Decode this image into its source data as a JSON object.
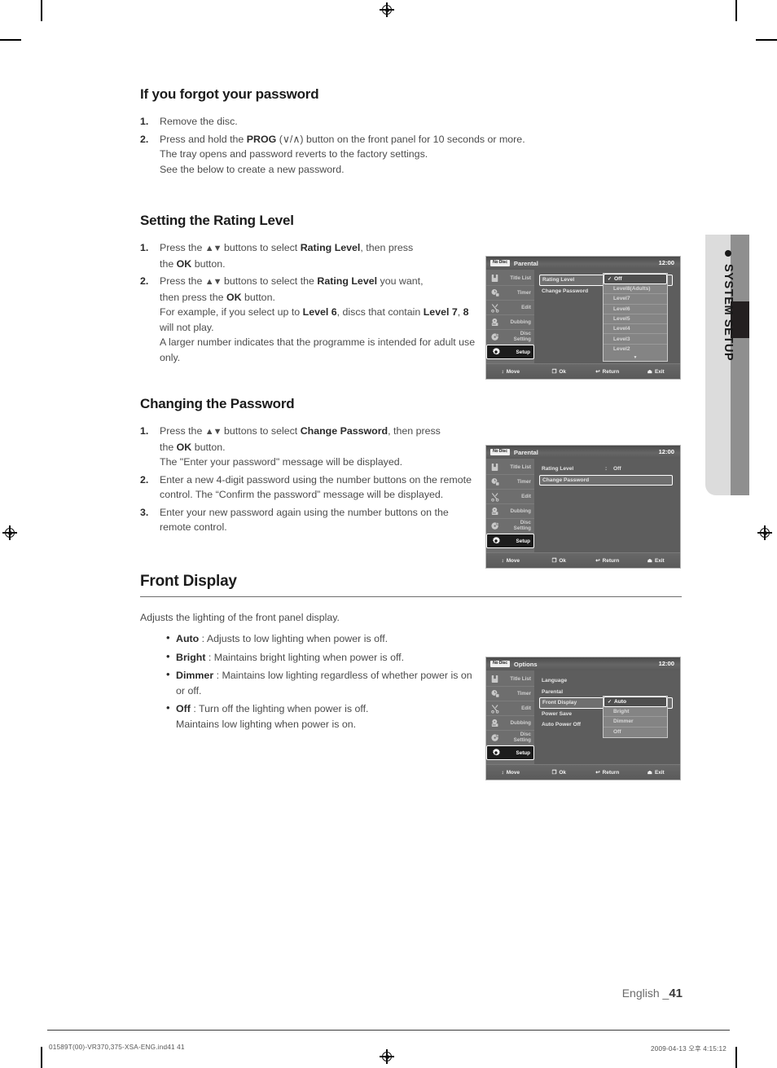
{
  "page": {
    "number": "41",
    "language_label": "English _",
    "side_tab": "SYSTEM SETUP",
    "footer_left": "01589T(00)-VR370,375-XSA-ENG.ind41   41",
    "footer_right": "2009-04-13   오후 4:15:12"
  },
  "sections": [
    {
      "id": "forgot_password",
      "title": "If you forgot your password",
      "steps": [
        {
          "num": "1.",
          "html": "Remove the disc."
        },
        {
          "num": "2.",
          "html": "Press and hold the <b>PROG</b> (∨/∧) button on the front panel for 10 seconds or more.<br>The tray opens and password reverts to the factory settings.<br>See the below  to create a new password."
        }
      ]
    },
    {
      "id": "rating_level",
      "title": "Setting the Rating Level",
      "steps": [
        {
          "num": "1.",
          "html": "Press the <span class=\"arrows\">▲▼</span> buttons to select <b>Rating Level</b>, then press<br>the <b>OK</b> button."
        },
        {
          "num": "2.",
          "html": "Press the <span class=\"arrows\">▲▼</span> buttons to select the <b>Rating Level</b> you want,<br>then press the <b>OK</b> button.<br>For example, if you select up to <b>Level 6</b>, discs that contain <b>Level 7</b>, <b>8</b> will not play.<br>A larger number indicates that the programme is intended for adult use only."
        }
      ]
    },
    {
      "id": "change_password",
      "title": "Changing the Password",
      "steps": [
        {
          "num": "1.",
          "html": "Press the <span class=\"arrows\">▲▼</span> buttons to select <b>Change Password</b>, then press<br>the <b>OK</b> button.<br>The \"Enter your password\" message will be displayed."
        },
        {
          "num": "2.",
          "html": "Enter a new 4-digit password using the number buttons on the remote control. The “Confirm the password” message will be displayed."
        },
        {
          "num": "3.",
          "html": "Enter your new password again using the number buttons on the remote control."
        }
      ]
    },
    {
      "id": "front_display",
      "title": "Front Display",
      "lead": "Adjusts the lighting of the front panel display.",
      "bullets": [
        {
          "term": "Auto",
          "desc": " : Adjusts to low lighting when power is off."
        },
        {
          "term": "Bright",
          "desc": " : Maintains bright lighting when power is off."
        },
        {
          "term": "Dimmer",
          "desc": " : Maintains low lighting regardless of whether power is on or off."
        },
        {
          "term": "Off",
          "desc": " : Turn off the lighting when power is off.<br>Maintains low lighting when power is on."
        }
      ]
    }
  ],
  "osd_common": {
    "disc_badge": "No Disc",
    "clock": "12:00",
    "sidebar": [
      {
        "label": "Title List",
        "icon": "title-list-icon"
      },
      {
        "label": "Timer",
        "icon": "timer-icon"
      },
      {
        "label": "Edit",
        "icon": "edit-scissors-icon"
      },
      {
        "label": "Dubbing",
        "icon": "dubbing-icon"
      },
      {
        "label": "Disc Setting",
        "icon": "disc-setting-icon"
      },
      {
        "label": "Setup",
        "icon": "gear-icon"
      }
    ],
    "footer": [
      {
        "icon": "↕",
        "label": "Move"
      },
      {
        "icon": "❐",
        "label": "Ok"
      },
      {
        "icon": "↩",
        "label": "Return"
      },
      {
        "icon": "⏏",
        "label": "Exit"
      }
    ]
  },
  "osd_rating": {
    "title": "Parental",
    "rows": [
      {
        "key": "Rating Level",
        "colon": ":",
        "value": "",
        "boxed": true
      },
      {
        "key": "Change Password",
        "colon": "",
        "value": "",
        "boxed": false
      }
    ],
    "dropdown": {
      "selected": "Off",
      "check": "✓",
      "options": [
        "Level8(Adults)",
        "Level7",
        "Level6",
        "Level5",
        "Level4",
        "Level3",
        "Level2"
      ],
      "more_icon": "▼"
    }
  },
  "osd_password": {
    "title": "Parental",
    "rows": [
      {
        "key": "Rating Level",
        "colon": ":",
        "value": "Off",
        "boxed": false
      },
      {
        "key": "Change Password",
        "colon": "",
        "value": "",
        "boxed": true
      }
    ]
  },
  "osd_options": {
    "title": "Options",
    "rows": [
      {
        "key": "Language",
        "colon": "",
        "value": "",
        "boxed": false
      },
      {
        "key": "Parental",
        "colon": "",
        "value": "",
        "boxed": false
      },
      {
        "key": "Front Display",
        "colon": ":",
        "value": "",
        "boxed": true
      },
      {
        "key": "Power Save",
        "colon": ":",
        "value": "",
        "boxed": false
      },
      {
        "key": "Auto Power Off",
        "colon": ":",
        "value": "",
        "boxed": false
      }
    ],
    "dropdown": {
      "selected": "Auto",
      "check": "✓",
      "options": [
        "Bright",
        "Dimmer",
        "Off"
      ]
    }
  }
}
